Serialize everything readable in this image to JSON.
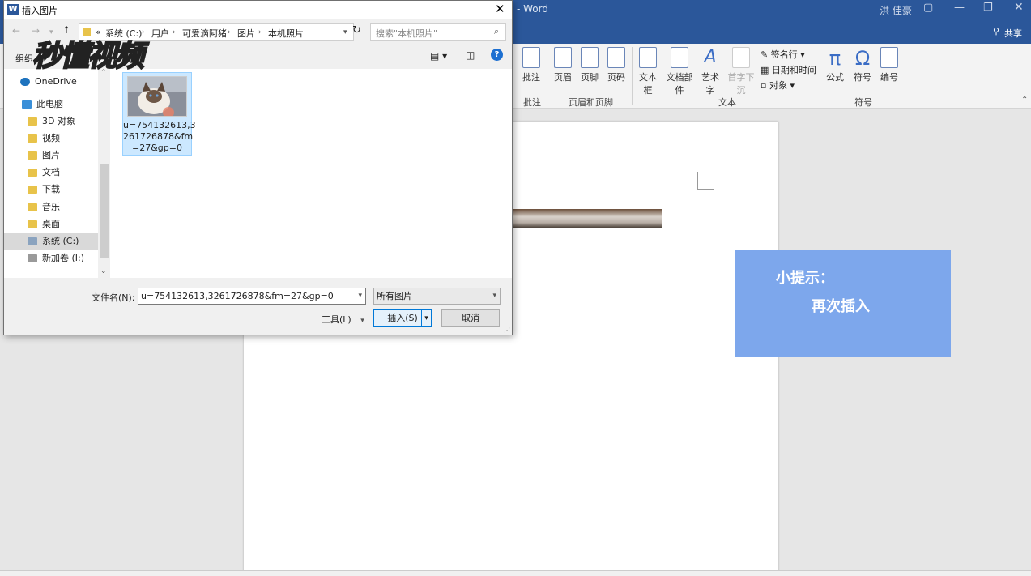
{
  "word": {
    "title_suffix": "- Word",
    "user": "洪 佳豪",
    "share": "共享",
    "ribbon": {
      "comment_group": {
        "button": "批注",
        "label": "批注"
      },
      "header_footer_group": {
        "buttons": [
          "页眉",
          "页脚",
          "页码"
        ],
        "label": "页眉和页脚"
      },
      "text_group": {
        "buttons": [
          "文本框",
          "文档部件",
          "艺术字",
          "首字下沉"
        ],
        "side": [
          "签名行",
          "日期和时间",
          "对象"
        ],
        "label": "文本"
      },
      "symbols_group": {
        "buttons": [
          "公式",
          "符号",
          "编号"
        ],
        "label": "符号"
      }
    }
  },
  "tip": {
    "title": "小提示：",
    "body": "再次插入"
  },
  "dialog": {
    "title": "插入图片",
    "breadcrumb": [
      "«",
      "系统 (C:)",
      "用户",
      "可爱滴阿猪",
      "图片",
      "本机照片"
    ],
    "search_placeholder": "搜索\"本机照片\"",
    "organize": "组织",
    "nav_items": [
      {
        "label": "OneDrive",
        "icon": "cloud-icon"
      },
      {
        "label": "此电脑",
        "icon": "computer-icon"
      },
      {
        "label": "3D 对象",
        "icon": "folder-icon"
      },
      {
        "label": "视频",
        "icon": "folder-icon"
      },
      {
        "label": "图片",
        "icon": "folder-icon"
      },
      {
        "label": "文档",
        "icon": "folder-icon"
      },
      {
        "label": "下载",
        "icon": "folder-icon"
      },
      {
        "label": "音乐",
        "icon": "folder-icon"
      },
      {
        "label": "桌面",
        "icon": "folder-icon"
      },
      {
        "label": "系统 (C:)",
        "icon": "drive-icon"
      },
      {
        "label": "新加卷 (I:)",
        "icon": "drive-icon"
      }
    ],
    "file": {
      "name_lines": [
        "u=754132613,3",
        "261726878&fm",
        "=27&gp=0"
      ]
    },
    "filename_label": "文件名(N):",
    "filename_value": "u=754132613,3261726878&fm=27&gp=0",
    "filetype_value": "所有图片",
    "tools_label": "工具(L)",
    "insert_label": "插入(S)",
    "cancel_label": "取消"
  },
  "watermark": "秒懂视频"
}
